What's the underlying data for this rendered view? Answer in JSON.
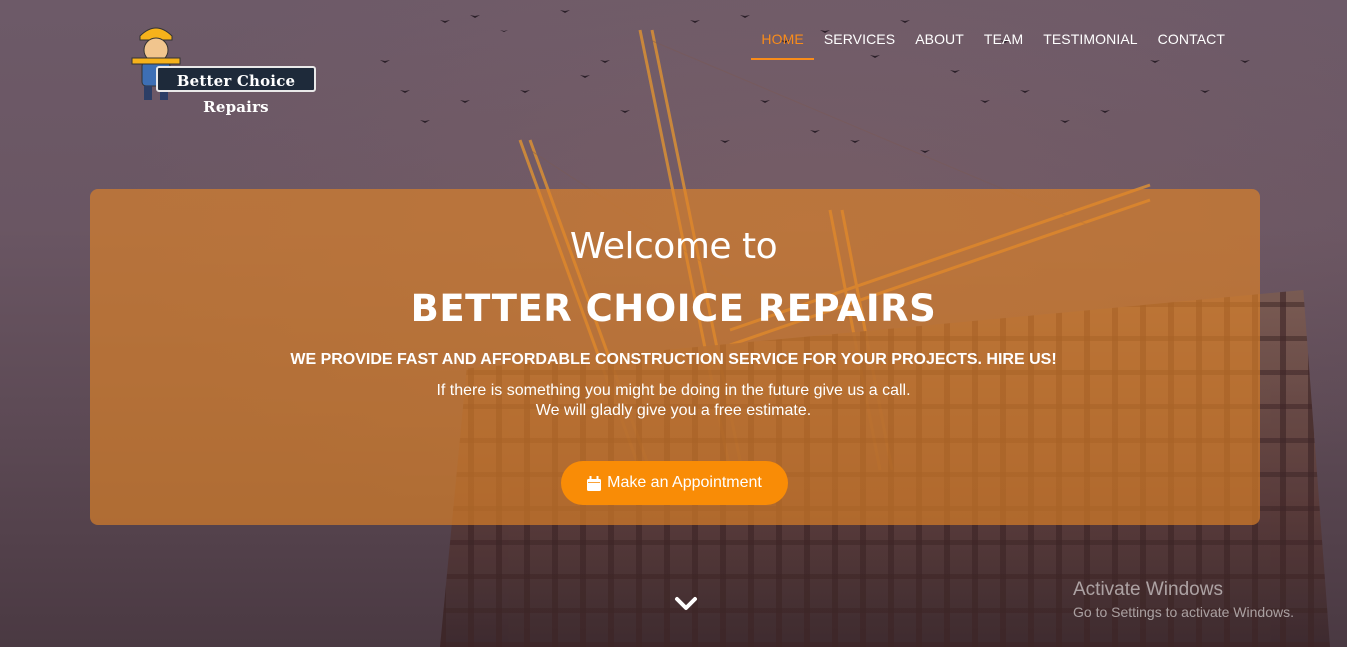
{
  "brand": {
    "logo_text": "Better Choice Repairs",
    "accent_color": "#f98c1a"
  },
  "nav": {
    "items": [
      {
        "label": "HOME",
        "active": true
      },
      {
        "label": "SERVICES",
        "active": false
      },
      {
        "label": "ABOUT",
        "active": false
      },
      {
        "label": "TEAM",
        "active": false
      },
      {
        "label": "TESTIMONIAL",
        "active": false
      },
      {
        "label": "CONTACT",
        "active": false
      }
    ]
  },
  "hero": {
    "welcome": "Welcome to",
    "title": "BETTER CHOICE REPAIRS",
    "tagline": "WE PROVIDE FAST AND AFFORDABLE CONSTRUCTION SERVICE FOR YOUR PROJECTS. HIRE US!",
    "description_line1": "If there is something you might be doing in the future give us a call.",
    "description_line2": "We will gladly give you a free estimate.",
    "cta_label": "Make an Appointment",
    "cta_icon": "calendar-icon",
    "scroll_icon": "chevron-down-icon"
  },
  "watermark": {
    "title": "Activate Windows",
    "subtitle": "Go to Settings to activate Windows."
  }
}
